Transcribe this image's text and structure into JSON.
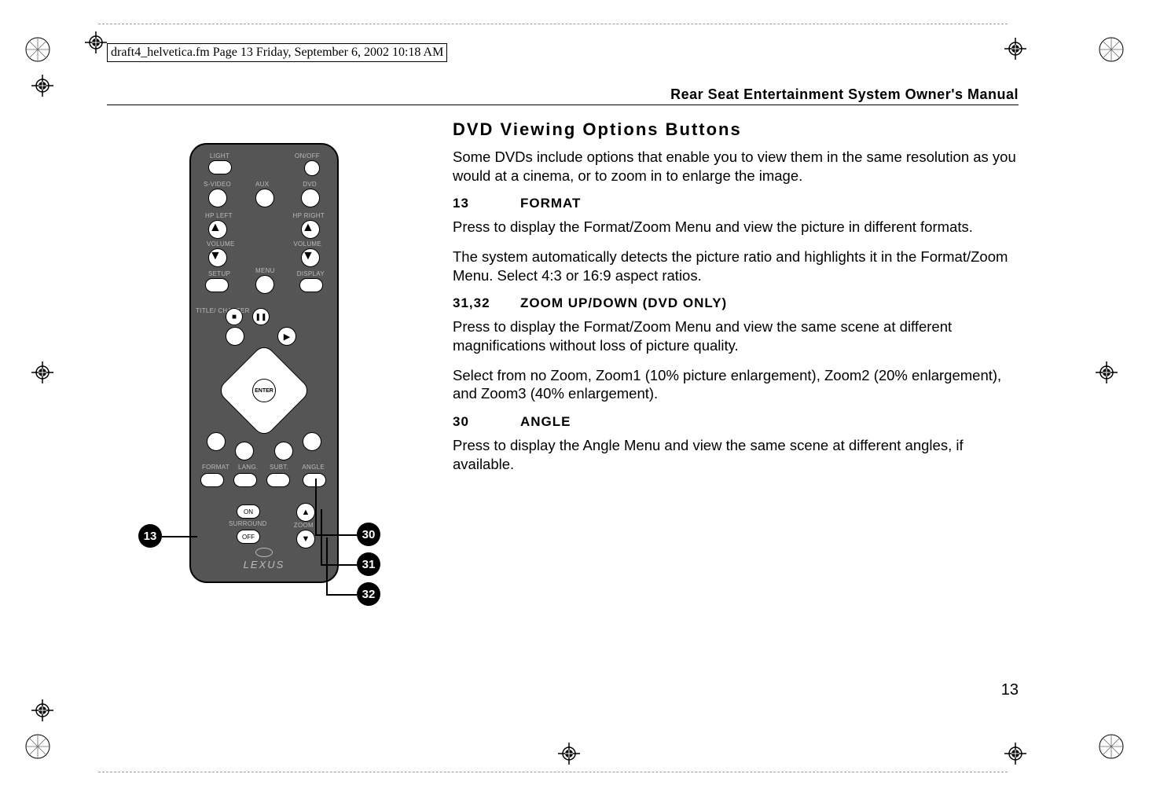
{
  "header_note": "draft4_helvetica.fm  Page 13  Friday, September 6, 2002  10:18 AM",
  "running_head": "Rear Seat Entertainment System Owner's Manual",
  "section_title": "DVD Viewing Options Buttons",
  "intro": "Some DVDs include options that enable you to view them in the same resolution as you would at a cinema, or to zoom in to enlarge the image.",
  "items": [
    {
      "num": "13",
      "name": "FORMAT",
      "paras": [
        "Press to display the Format/Zoom Menu and view the picture in different formats.",
        "The system automatically detects the picture ratio and highlights it in the Format/Zoom Menu. Select 4:3 or 16:9 aspect ratios."
      ]
    },
    {
      "num": "31,32",
      "name": "ZOOM UP/DOWN (DVD ONLY)",
      "paras": [
        "Press to display the Format/Zoom Menu and view the same scene at different magnifications without loss of picture quality.",
        "Select from no Zoom, Zoom1 (10% picture enlargement), Zoom2 (20% enlargement), and Zoom3 (40% enlargement)."
      ]
    },
    {
      "num": "30",
      "name": "ANGLE",
      "paras": [
        "Press to display the Angle Menu and view the same scene at different angles, if available."
      ]
    }
  ],
  "page_number": "13",
  "remote": {
    "labels": {
      "light": "LIGHT",
      "onoff": "ON/OFF",
      "svideo": "S-VIDEO",
      "aux": "AUX",
      "dvd": "DVD",
      "hp_left": "HP LEFT",
      "hp_right": "HP RIGHT",
      "volume": "VOLUME",
      "setup": "SETUP",
      "menu": "MENU",
      "display": "DISPLAY",
      "title_chapter": "TITLE/\nCHAPTER",
      "format": "FORMAT",
      "lang": "LANG.",
      "subt": "SUBT.",
      "angle": "ANGLE",
      "on": "ON",
      "surround": "SURROUND",
      "off": "OFF",
      "zoom": "ZOOM",
      "enter": "ENTER"
    },
    "logo": "LEXUS",
    "callouts": {
      "c13": "13",
      "c30": "30",
      "c31": "31",
      "c32": "32"
    }
  }
}
